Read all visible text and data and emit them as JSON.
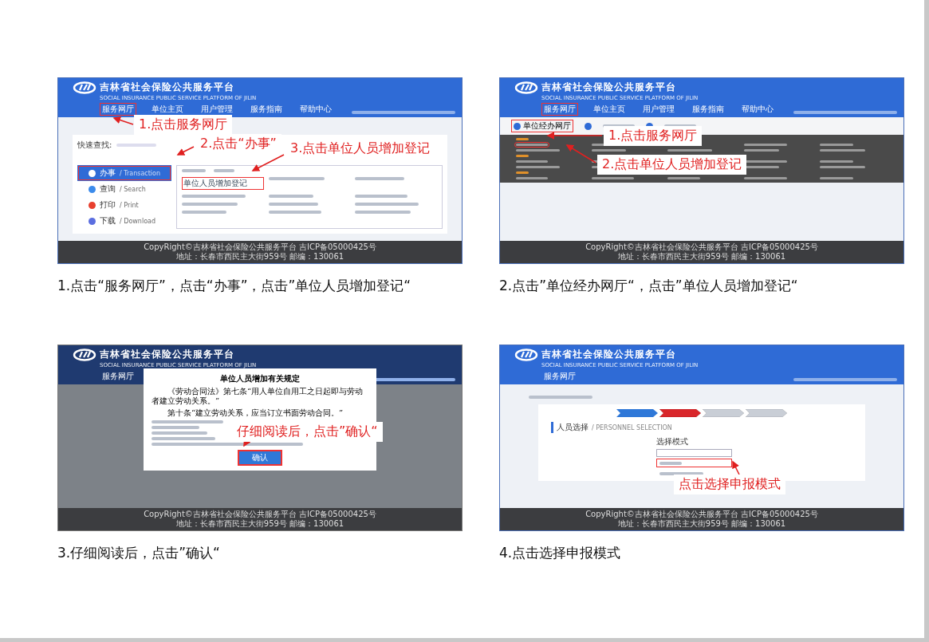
{
  "panels": [
    {
      "kind": "home",
      "header": {
        "title": "吉林省社会保险公共服务平台",
        "subtitle": "SOCIAL INSURANCE PUBLIC SERVICE PLATFORM OF JILIN",
        "nav": [
          {
            "label": "服务网厅",
            "highlighted": true
          },
          {
            "label": "单位主页",
            "highlighted": false
          },
          {
            "label": "用户管理",
            "highlighted": false
          },
          {
            "label": "服务指南",
            "highlighted": false
          },
          {
            "label": "帮助中心",
            "highlighted": false
          }
        ]
      },
      "quick_search": "快速查找:",
      "menu": [
        {
          "label": "办事",
          "english": "/ Transaction",
          "selected": true,
          "color": "#ffffff"
        },
        {
          "label": "查询",
          "english": "/ Search",
          "selected": false,
          "color": "#3b8beb"
        },
        {
          "label": "打印",
          "english": "/ Print",
          "selected": false,
          "color": "#e8402f"
        },
        {
          "label": "下载",
          "english": "/ Download",
          "selected": false,
          "color": "#5b6ee0"
        }
      ],
      "grid": [
        {
          "label": "单位人员增加登记",
          "highlighted": true
        }
      ],
      "annotations": [
        "1.点击服务网厅",
        "2.点击“办事”",
        "3.点击单位人员增加登记"
      ],
      "footer": [
        "CopyRight©吉林省社会保险公共服务平台 吉ICP备05000425号",
        "地址：长春市西民主大街959号 邮编：130061"
      ],
      "caption": "1.点击“服务网厅”，点击“办事”，点击”单位人员增加登记“"
    },
    {
      "kind": "hall",
      "header": {
        "title": "吉林省社会保险公共服务平台",
        "subtitle": "SOCIAL INSURANCE PUBLIC SERVICE PLATFORM OF JILIN",
        "nav": [
          {
            "label": "服务网厅",
            "highlighted": true
          },
          {
            "label": "单位主页",
            "highlighted": false
          },
          {
            "label": "用户管理",
            "highlighted": false
          },
          {
            "label": "服务指南",
            "highlighted": false
          },
          {
            "label": "帮助中心",
            "highlighted": false
          }
        ]
      },
      "subnav": {
        "label": "单位经办网厅",
        "highlighted": true
      },
      "first_item_highlighted": true,
      "annotations": [
        "1.点击服务网厅",
        "2.点击单位人员增加登记"
      ],
      "footer": [
        "CopyRight©吉林省社会保险公共服务平台 吉ICP备05000425号",
        "地址：长春市西民主大街959号 邮编：130061"
      ],
      "caption": "2.点击”单位经办网厅“，点击”单位人员增加登记“"
    },
    {
      "kind": "dialog",
      "header": {
        "title": "吉林省社会保险公共服务平台",
        "subtitle": "SOCIAL INSURANCE PUBLIC SERVICE PLATFORM OF JILIN",
        "nav": [
          {
            "label": "服务网厅",
            "highlighted": false
          }
        ]
      },
      "modal": {
        "title": "单位人员增加有关规定",
        "paragraphs": [
          "《劳动合同法》第七条“用人单位自用工之日起即与劳动者建立劳动关系。”",
          "第十条“建立劳动关系，应当订立书面劳动合同。”"
        ],
        "button": {
          "label": "确认",
          "highlighted": true
        }
      },
      "annotations": [
        "仔细阅读后，点击”确认“"
      ],
      "footer": [
        "CopyRight©吉林省社会保险公共服务平台 吉ICP备05000425号",
        "地址：长春市西民主大街959号 邮编：130061"
      ],
      "caption": "3.仔细阅读后，点击”确认“"
    },
    {
      "kind": "mode",
      "header": {
        "title": "吉林省社会保险公共服务平台",
        "subtitle": "SOCIAL INSURANCE PUBLIC SERVICE PLATFORM OF JILIN",
        "nav": [
          {
            "label": "服务网厅",
            "highlighted": false
          }
        ]
      },
      "steps": [
        {
          "completed": true,
          "selected": false
        },
        {
          "completed": false,
          "selected": true
        },
        {
          "completed": false,
          "selected": false
        },
        {
          "completed": false,
          "selected": false
        }
      ],
      "section": {
        "title": "人员选择",
        "english": "/ PERSONNEL SELECTION"
      },
      "field_label": "选择模式",
      "options": [
        {
          "highlighted": true
        },
        {
          "highlighted": false
        }
      ],
      "annotations": [
        "点击选择申报模式"
      ],
      "footer": [
        "CopyRight©吉林省社会保险公共服务平台 吉ICP备05000425号",
        "地址：长春市西民主大街959号 邮编：130061"
      ],
      "caption": "4.点击选择申报模式"
    }
  ]
}
